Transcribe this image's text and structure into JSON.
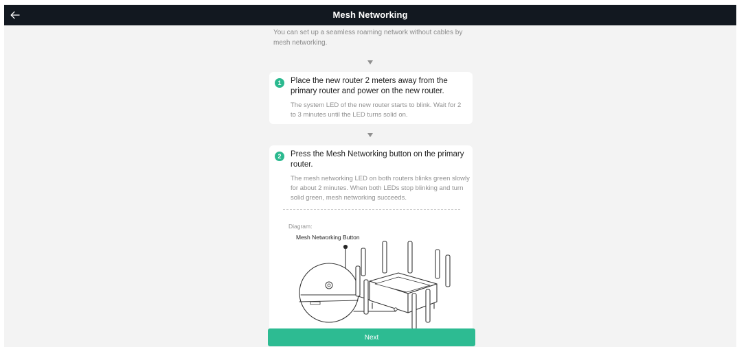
{
  "header": {
    "title": "Mesh Networking",
    "back_icon": "arrow-left-icon"
  },
  "intro": "You can set up a seamless roaming network without cables by mesh networking.",
  "steps": [
    {
      "number": "1",
      "title": "Place the new router 2 meters away from the primary router and power on the new router.",
      "description": "The system LED of the new router starts to blink. Wait for 2 to 3 minutes until the LED turns solid on."
    },
    {
      "number": "2",
      "title": "Press the Mesh Networking button on the primary router.",
      "description": "The mesh networking LED on both routers blinks green slowly for about 2 minutes. When both LEDs stop blinking and turn solid green, mesh networking succeeds."
    }
  ],
  "diagram": {
    "label": "Diagram:",
    "callout": "Mesh Networking Button"
  },
  "next_button": "Next",
  "colors": {
    "header_bg": "#121820",
    "accent": "#2dbb92",
    "page_bg": "#f3f3f3"
  }
}
